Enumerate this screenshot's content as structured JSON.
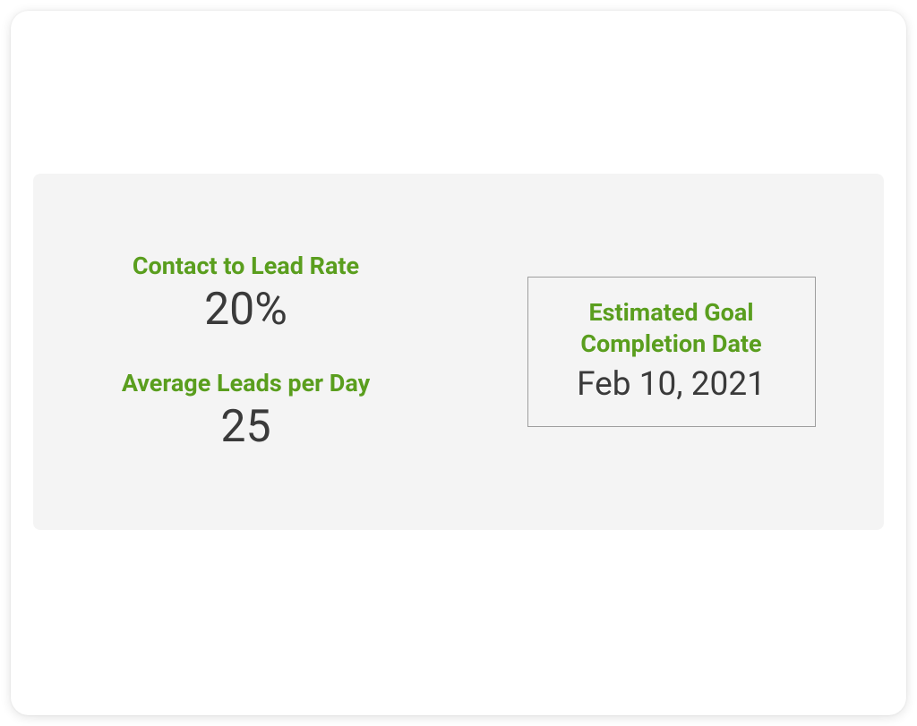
{
  "metrics": {
    "contact_to_lead": {
      "label": "Contact to Lead Rate",
      "value": "20%"
    },
    "avg_leads_per_day": {
      "label": "Average Leads per Day",
      "value": "25"
    }
  },
  "goal": {
    "label_line1": "Estimated Goal",
    "label_line2": "Completion Date",
    "value": "Feb 10, 2021"
  }
}
